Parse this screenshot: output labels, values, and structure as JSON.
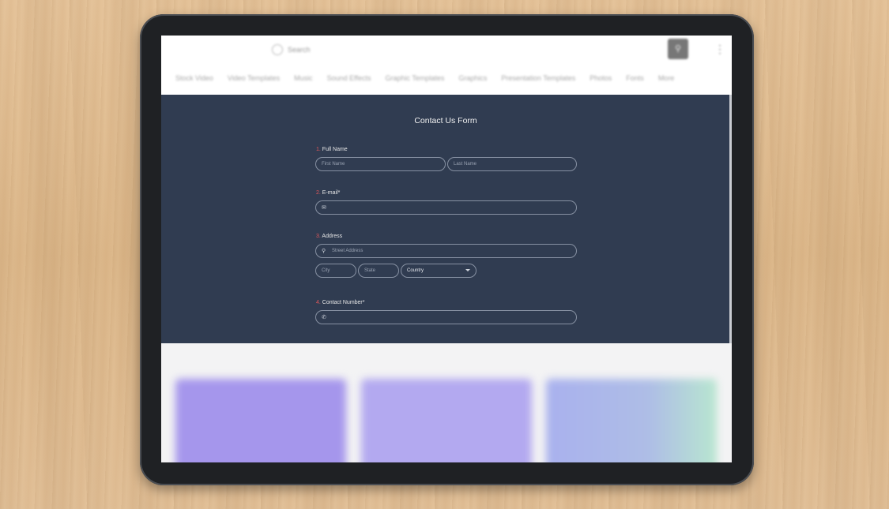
{
  "header": {
    "search_placeholder": "Search",
    "search_button_icon": "search-icon",
    "menu_icon": "more-vertical-icon",
    "nav": [
      "Stock Video",
      "Video Templates",
      "Music",
      "Sound Effects",
      "Graphic Templates",
      "Graphics",
      "Presentation Templates",
      "Photos",
      "Fonts",
      "More"
    ]
  },
  "form": {
    "title": "Contact Us Form",
    "sections": {
      "full_name": {
        "number": "1.",
        "label": "Full Name",
        "first_placeholder": "First Name",
        "last_placeholder": "Last Name"
      },
      "email": {
        "number": "2.",
        "label": "E-mail",
        "required": "*",
        "icon": "mail-icon"
      },
      "address": {
        "number": "3.",
        "label": "Address",
        "street_placeholder": "Street Address",
        "street_icon": "location-pin-icon",
        "city_placeholder": "City",
        "state_placeholder": "State",
        "country_value": "Country"
      },
      "contact": {
        "number": "4.",
        "label": "Contact Number",
        "required": "*",
        "icon": "phone-icon"
      }
    }
  },
  "colors": {
    "panel_bg": "#303c51",
    "accent_number": "#e0575a"
  }
}
